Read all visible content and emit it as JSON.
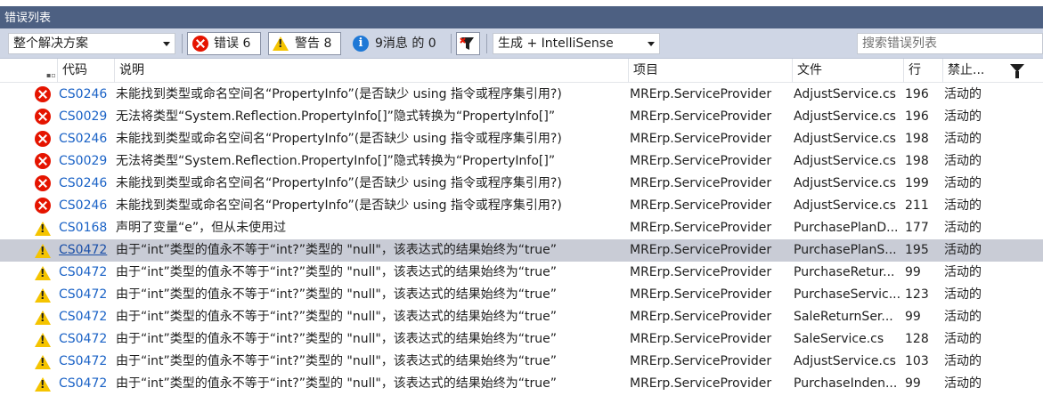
{
  "window": {
    "title": "错误列表"
  },
  "toolbar": {
    "scope": "整个解决方案",
    "errors_label": "错误 6",
    "warnings_label": "警告 8",
    "messages_label": "9消息 的 0",
    "build_source": "生成 + IntelliSense",
    "search_placeholder": "搜索错误列表"
  },
  "columns": {
    "code": "代码",
    "description": "说明",
    "project": "项目",
    "file": "文件",
    "line": "行",
    "suppression": "禁止..."
  },
  "rows": [
    {
      "kind": "error",
      "code": "CS0246",
      "description": "未能找到类型或命名空间名“PropertyInfo”(是否缺少 using 指令或程序集引用?)",
      "project": "MRErp.ServiceProvider",
      "file": "AdjustService.cs",
      "line": "196",
      "state": "活动的"
    },
    {
      "kind": "error",
      "code": "CS0029",
      "description": "无法将类型“System.Reflection.PropertyInfo[]”隐式转换为“PropertyInfo[]”",
      "project": "MRErp.ServiceProvider",
      "file": "AdjustService.cs",
      "line": "196",
      "state": "活动的"
    },
    {
      "kind": "error",
      "code": "CS0246",
      "description": "未能找到类型或命名空间名“PropertyInfo”(是否缺少 using 指令或程序集引用?)",
      "project": "MRErp.ServiceProvider",
      "file": "AdjustService.cs",
      "line": "198",
      "state": "活动的"
    },
    {
      "kind": "error",
      "code": "CS0029",
      "description": "无法将类型“System.Reflection.PropertyInfo[]”隐式转换为“PropertyInfo[]”",
      "project": "MRErp.ServiceProvider",
      "file": "AdjustService.cs",
      "line": "198",
      "state": "活动的"
    },
    {
      "kind": "error",
      "code": "CS0246",
      "description": "未能找到类型或命名空间名“PropertyInfo”(是否缺少 using 指令或程序集引用?)",
      "project": "MRErp.ServiceProvider",
      "file": "AdjustService.cs",
      "line": "199",
      "state": "活动的"
    },
    {
      "kind": "error",
      "code": "CS0246",
      "description": "未能找到类型或命名空间名“PropertyInfo”(是否缺少 using 指令或程序集引用?)",
      "project": "MRErp.ServiceProvider",
      "file": "AdjustService.cs",
      "line": "211",
      "state": "活动的"
    },
    {
      "kind": "warning",
      "code": "CS0168",
      "description": "声明了变量“e”，但从未使用过",
      "project": "MRErp.ServiceProvider",
      "file": "PurchasePlanD...",
      "line": "177",
      "state": "活动的"
    },
    {
      "kind": "warning",
      "code": "CS0472",
      "description": "由于“int”类型的值永不等于“int?”类型的 \"null\"，该表达式的结果始终为“true”",
      "project": "MRErp.ServiceProvider",
      "file": "PurchasePlanS...",
      "line": "195",
      "state": "活动的",
      "selected": true
    },
    {
      "kind": "warning",
      "code": "CS0472",
      "description": "由于“int”类型的值永不等于“int?”类型的 \"null\"，该表达式的结果始终为“true”",
      "project": "MRErp.ServiceProvider",
      "file": "PurchaseRetur...",
      "line": "99",
      "state": "活动的"
    },
    {
      "kind": "warning",
      "code": "CS0472",
      "description": "由于“int”类型的值永不等于“int?”类型的 \"null\"，该表达式的结果始终为“true”",
      "project": "MRErp.ServiceProvider",
      "file": "PurchaseServic...",
      "line": "123",
      "state": "活动的"
    },
    {
      "kind": "warning",
      "code": "CS0472",
      "description": "由于“int”类型的值永不等于“int?”类型的 \"null\"，该表达式的结果始终为“true”",
      "project": "MRErp.ServiceProvider",
      "file": "SaleReturnSer...",
      "line": "99",
      "state": "活动的"
    },
    {
      "kind": "warning",
      "code": "CS0472",
      "description": "由于“int”类型的值永不等于“int?”类型的 \"null\"，该表达式的结果始终为“true”",
      "project": "MRErp.ServiceProvider",
      "file": "SaleService.cs",
      "line": "128",
      "state": "活动的"
    },
    {
      "kind": "warning",
      "code": "CS0472",
      "description": "由于“int”类型的值永不等于“int?”类型的 \"null\"，该表达式的结果始终为“true”",
      "project": "MRErp.ServiceProvider",
      "file": "AdjustService.cs",
      "line": "103",
      "state": "活动的"
    },
    {
      "kind": "warning",
      "code": "CS0472",
      "description": "由于“int”类型的值永不等于“int?”类型的 \"null\"，该表达式的结果始终为“true”",
      "project": "MRErp.ServiceProvider",
      "file": "PurchaseInden...",
      "line": "99",
      "state": "活动的"
    }
  ],
  "colors": {
    "title_bar": "#4d6082",
    "toolbar": "#cfd6e5",
    "selected_row": "#c9ccd6",
    "link": "#1a62c6",
    "error": "#e51400",
    "warning": "#f5c400",
    "info": "#1e78d6"
  }
}
